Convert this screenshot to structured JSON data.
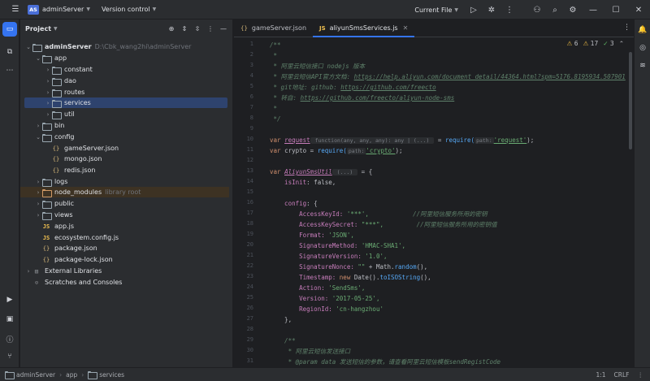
{
  "titlebar": {
    "project_badge": "AS",
    "project_name": "adminServer",
    "vcs": "Version control",
    "run_config": "Current File",
    "icons": [
      "main-menu-icon",
      "run-icon",
      "debug-icon",
      "more-icon",
      "add-user-icon",
      "search-icon",
      "settings-icon",
      "minimize-icon",
      "maximize-icon",
      "close-icon"
    ]
  },
  "project_panel": {
    "title": "Project",
    "tree": [
      {
        "label": "adminServer",
        "path": "D:\\Cbk_wang2hi\\adminServer",
        "type": "folder",
        "expanded": true
      },
      {
        "label": "app",
        "type": "folder",
        "expanded": true
      },
      {
        "label": "constant",
        "type": "folder"
      },
      {
        "label": "dao",
        "type": "folder"
      },
      {
        "label": "routes",
        "type": "folder"
      },
      {
        "label": "services",
        "type": "folder",
        "selected": true
      },
      {
        "label": "util",
        "type": "folder"
      },
      {
        "label": "bin",
        "type": "folder"
      },
      {
        "label": "config",
        "type": "folder",
        "expanded": true
      },
      {
        "label": "gameServer.json",
        "type": "json"
      },
      {
        "label": "mongo.json",
        "type": "json"
      },
      {
        "label": "redis.json",
        "type": "json"
      },
      {
        "label": "logs",
        "type": "folder"
      },
      {
        "label": "node_modules",
        "path": "library root",
        "type": "folder-excluded"
      },
      {
        "label": "public",
        "type": "folder"
      },
      {
        "label": "views",
        "type": "folder"
      },
      {
        "label": "app.js",
        "type": "js"
      },
      {
        "label": "ecosystem.config.js",
        "type": "js"
      },
      {
        "label": "package.json",
        "type": "json"
      },
      {
        "label": "package-lock.json",
        "type": "json"
      },
      {
        "label": "External Libraries",
        "type": "lib"
      },
      {
        "label": "Scratches and Consoles",
        "type": "scratch"
      }
    ]
  },
  "editor": {
    "tabs": [
      {
        "label": "gameServer.json",
        "type": "json"
      },
      {
        "label": "aliyunSmsServices.js",
        "type": "js",
        "active": true
      }
    ],
    "inspections": {
      "warnings": "6",
      "weak_warnings": "17",
      "typos": "3"
    },
    "line_numbers": [
      "1",
      "2",
      "3",
      "4",
      "5",
      "6",
      "7",
      "8",
      "9",
      "10",
      "11",
      "12",
      "13",
      "14",
      "15",
      "16",
      "17",
      "18",
      "19",
      "20",
      "21",
      "22",
      "23",
      "24",
      "25",
      "26",
      "27",
      "28",
      "29",
      "30",
      "31"
    ],
    "code": {
      "l1": "/**",
      "l2": " *",
      "l3": " * 阿里云短信接口 nodejs 版本",
      "l4a": " * 阿里云短信API官方文档: ",
      "l4b": "https://help.aliyun.com/document_detail/44364.html?spm=5176.8195934.507901",
      "l5a": " * git地址: github: ",
      "l5b": "https://github.com/freecto",
      "l6a": " * 转自: ",
      "l6b": "https://github.com/freecto/aliyun-node-sms",
      "l7": " *",
      "l8": " */",
      "l11_kw": "var ",
      "l11_name": "request",
      "l11_hint": " function(any, any, any): any | (...) ",
      "l11_eq": " = ",
      "l11_fn": "require(",
      "l11_phint": "path:",
      "l11_str": "'request'",
      "l11_end": ");",
      "l12_kw": "var ",
      "l12_name": "crypto = ",
      "l12_fn": "require(",
      "l12_phint": "path:",
      "l12_str": "'crypto'",
      "l12_end": ");",
      "l14_kw": "var ",
      "l14_name": "AliyunSmsUtil",
      "l14_hint": " (...) ",
      "l14_end": " = {",
      "l15a": "    isInit",
      "l15b": ": false,",
      "l17a": "    config",
      "l17b": ": {",
      "l18a": "        AccessKeyId: ",
      "l18b": "'***',",
      "l18c": "            //阿里短信服务所用的密钥",
      "l19a": "        AccessKeySecret: ",
      "l19b": "\"***\",",
      "l19c": "         //阿里短信服务所用的密钥值",
      "l20a": "        Format: ",
      "l20b": "'JSON',",
      "l21a": "        SignatureMethod: ",
      "l21b": "'HMAC-SHA1',",
      "l22a": "        SignatureVersion: ",
      "l22b": "'1.0',",
      "l23a": "        SignatureNonce: ",
      "l23b": "\"\"",
      "l23c": " + Math.",
      "l23d": "random",
      "l23e": "(),",
      "l24a": "        Timestamp: ",
      "l24b": "new ",
      "l24c": "Date().",
      "l24d": "toISOString",
      "l24e": "(),",
      "l25a": "        Action: ",
      "l25b": "'SendSms',",
      "l26a": "        Version: ",
      "l26b": "'2017-05-25',",
      "l27a": "        RegionId: ",
      "l27b": "'cn-hangzhou'",
      "l28": "    },",
      "l30": "    /**",
      "l31a": "     * 阿里云短信发送接口",
      "l32a": "     * @param data ",
      "l32b": "发送短信的参数，请查看阿里云短信模板sendRegistCode"
    }
  },
  "statusbar": {
    "crumbs": [
      "adminServer",
      "app",
      "services"
    ],
    "position": "1:1",
    "line_ending": "CRLF",
    "more": "⋮"
  }
}
